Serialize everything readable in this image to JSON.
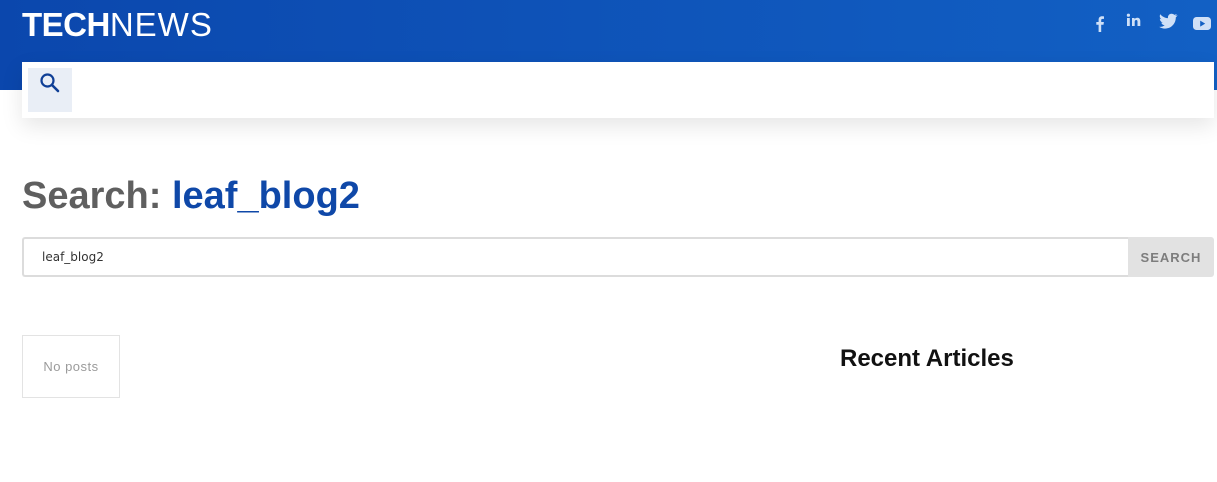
{
  "header": {
    "logo": {
      "bold": "TECH",
      "light": "NEWS"
    },
    "social": [
      {
        "icon": "facebook-icon"
      },
      {
        "icon": "linkedin-icon"
      },
      {
        "icon": "twitter-icon"
      },
      {
        "icon": "youtube-icon"
      }
    ]
  },
  "nav": {
    "search_icon": "search-icon"
  },
  "page": {
    "heading_label": "Search:",
    "heading_query": "leaf_blog2",
    "search_value": "leaf_blog2",
    "search_button": "SEARCH",
    "no_posts": "No posts",
    "sidebar_title": "Recent Articles"
  },
  "colors": {
    "header_start": "#0b47ad",
    "header_end": "#1260c4",
    "query_accent": "#0f48a8"
  }
}
